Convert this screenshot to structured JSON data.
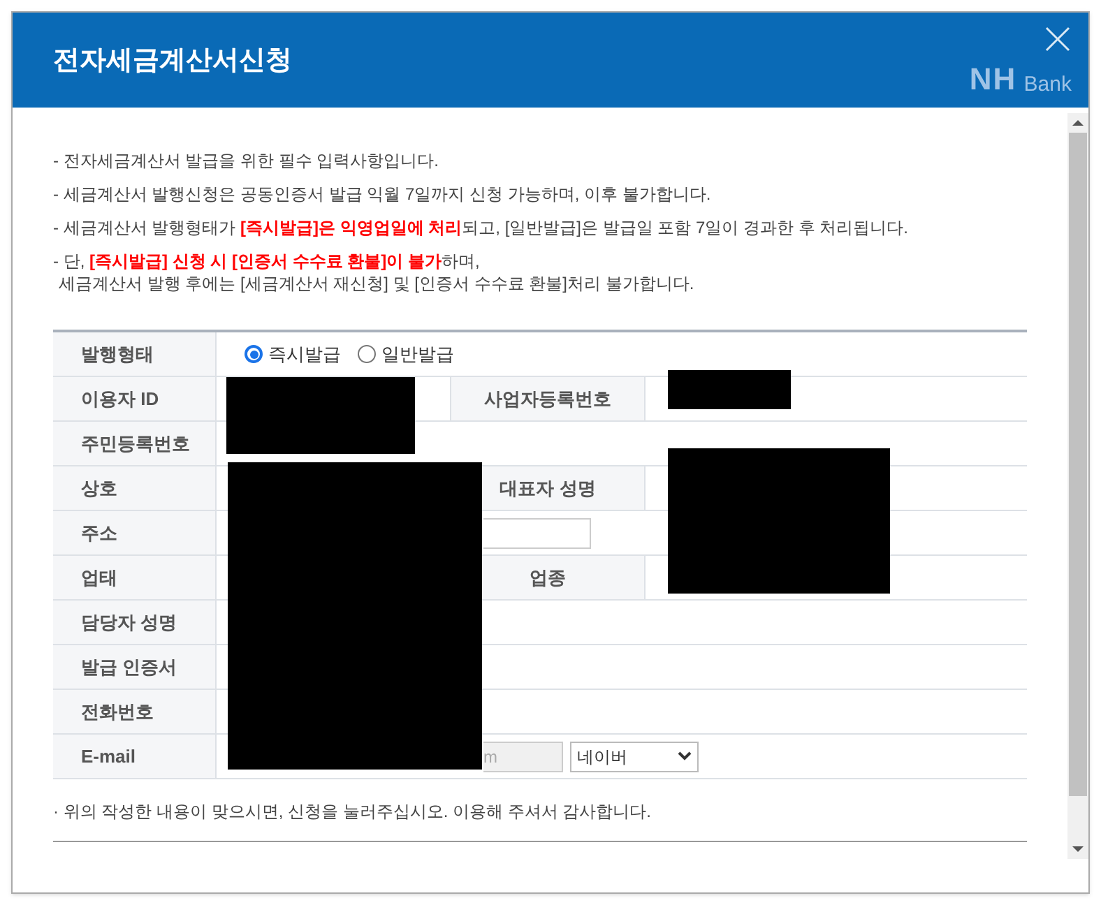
{
  "dialog": {
    "title": "전자세금계산서신청",
    "logo": {
      "mark": "NH",
      "text": "Bank"
    }
  },
  "notices": [
    {
      "kind": "item",
      "text": "- 전자세금계산서 발급을 위한 필수 입력사항입니다."
    },
    {
      "kind": "item",
      "text": "- 세금계산서 발행신청은 공동인증서 발급 익월 7일까지 신청 가능하며, 이후 불가합니다."
    },
    {
      "kind": "item",
      "text": "- 세금계산서 발행형태가 **[즉시발급]은 익영업일에 처리**되고, [일반발급]은 발급일 포함 7일이 경과한 후 처리됩니다."
    },
    {
      "kind": "item",
      "text": "- 단, **[즉시발급] 신청 시 [인증서 수수료 환불]이 불가**하며,"
    },
    {
      "kind": "continuation",
      "text": "세금계산서 발행 후에는 [세금계산서 재신청] 및 [인증서 수수료 환불]처리 불가합니다."
    }
  ],
  "form_rows": [
    {
      "kind": "radio",
      "label": "발행형태",
      "options": [
        {
          "label": "즉시발급",
          "selected": true
        },
        {
          "label": "일반발급",
          "selected": false
        }
      ]
    },
    {
      "kind": "pair",
      "label": "이용자 ID",
      "label_2": "사업자등록번호"
    },
    {
      "kind": "single",
      "label": "주민등록번호"
    },
    {
      "kind": "pair",
      "label": "상호",
      "label_2": "대표자 성명"
    },
    {
      "kind": "address",
      "label": "주소"
    },
    {
      "kind": "pair",
      "label": "업태",
      "label_2": "업종"
    },
    {
      "kind": "single",
      "label": "담당자 성명"
    },
    {
      "kind": "single",
      "label": "발급 인증서"
    },
    {
      "kind": "single",
      "label": "전화번호"
    },
    {
      "kind": "email",
      "label": "E-mail",
      "domain_value": "m",
      "provider": "네이버"
    }
  ],
  "footer_note": "· 위의 작성한 내용이 맞으시면, 신청을 눌러주십시오. 이용해 주셔서 감사합니다."
}
